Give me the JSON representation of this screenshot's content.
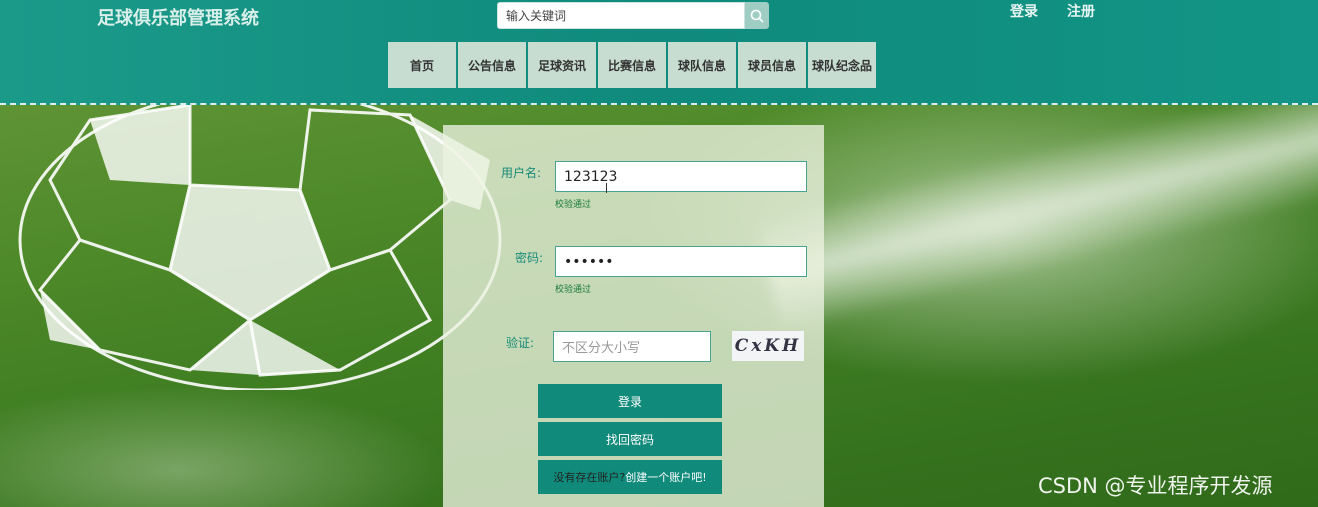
{
  "header": {
    "site_title": "足球俱乐部管理系统",
    "search": {
      "placeholder": "输入关键词",
      "icon": "search-icon"
    },
    "login_link": "登录",
    "register_link": "注册"
  },
  "nav": {
    "items": [
      "首页",
      "公告信息",
      "足球资讯",
      "比赛信息",
      "球队信息",
      "球员信息",
      "球队纪念品"
    ]
  },
  "login_form": {
    "username": {
      "label": "用户名:",
      "value": "123123",
      "hint": "校验通过"
    },
    "password": {
      "label": "密码:",
      "value": "••••••",
      "hint": "校验通过"
    },
    "captcha": {
      "label": "验证:",
      "placeholder": "不区分大小写",
      "image_text": "CxKH"
    },
    "login_button": "登录",
    "forgot_button": "找回密码",
    "register_prompt": "没有存在账户?",
    "register_action": "创建一个账户吧!"
  },
  "watermark": "CSDN @专业程序开发源",
  "colors": {
    "header": "#0f8a7c",
    "button": "#108a7a",
    "nav_item": "#c8ddd1"
  }
}
